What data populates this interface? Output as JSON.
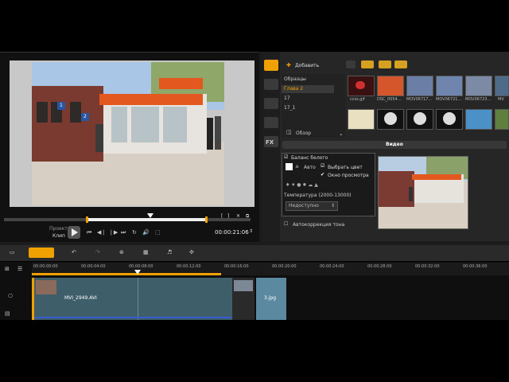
{
  "preview": {
    "project_label": "Проект",
    "clip_label": "Клип",
    "timecode": "00:00:21:06",
    "scrub_position": 0.59,
    "sign_number_1": "2",
    "sign_number_2": "1"
  },
  "library": {
    "add_label": "Добавить",
    "folders": [
      "Образцы",
      "Глава 2",
      "17",
      "17_1"
    ],
    "selected_folder": "Глава 2",
    "browse_label": "Обзор",
    "thumbnails_row1": [
      "ccss.gif",
      "DSC_0054...",
      "MOV06717...",
      "MOV06721...",
      "MOV06723...",
      "MV"
    ],
    "fx_label": "FX"
  },
  "options": {
    "tab_video": "Видео",
    "white_balance": "Баланс белого",
    "auto": "Авто",
    "pick_color": "Выбрать цвет",
    "preview_window": "Окно просмотра",
    "temperature": "Температура (2000-13000)",
    "unavailable": "Недоступно",
    "auto_tone": "Автокоррекция тона"
  },
  "timeline": {
    "ruler_ticks": [
      "00:00:00:00",
      "00:00:04:00",
      "00:00:08:00",
      "00:00:12:00",
      "00:00:16:00",
      "00:00:20:00",
      "00:00:24:00",
      "00:00:28:00",
      "00:00:32:00",
      "00:00:36:00"
    ],
    "clip_name": "MVI_2949.AVI",
    "clip2_name": "3.jpg"
  },
  "colors": {
    "accent_orange": "#f0a000",
    "clip_teal": "#3e5f6a",
    "dark_bg": "#1c1c1c"
  }
}
